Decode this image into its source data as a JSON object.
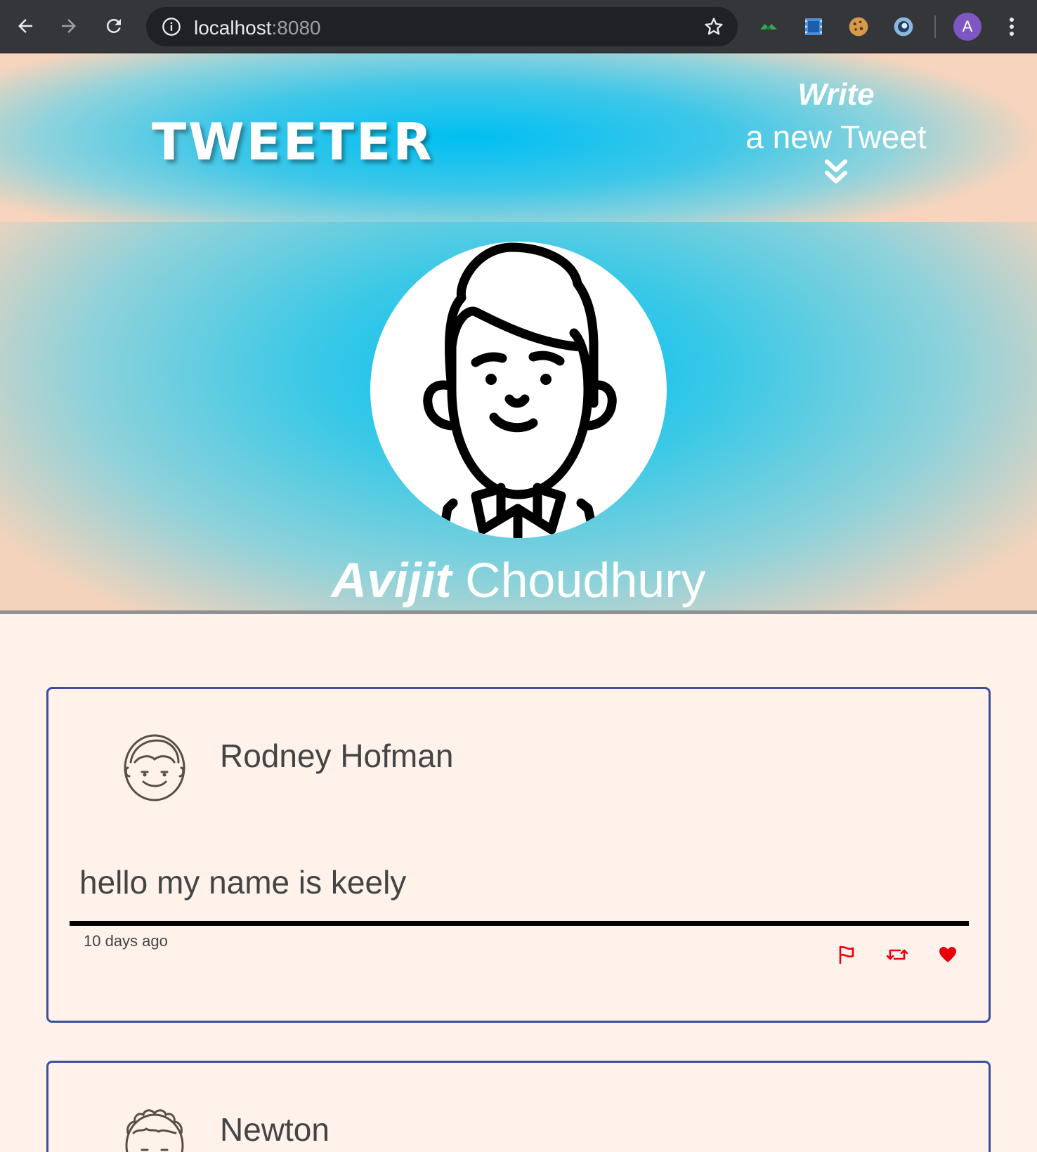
{
  "browser": {
    "url_host": "localhost",
    "url_port": ":8080",
    "profile_initial": "A"
  },
  "nav": {
    "logo": "TWEETER",
    "compose_write": "Write",
    "compose_new": "a new Tweet"
  },
  "profile": {
    "first_name": "Avijit",
    "last_name": "Choudhury"
  },
  "tweets": [
    {
      "user": "Rodney Hofman",
      "content": "hello my name is keely",
      "time": "10 days ago"
    },
    {
      "user": "Newton"
    }
  ],
  "colors": {
    "accent_red": "#e8000b",
    "card_border": "#3b4f9e",
    "page_bg": "#fef2ea",
    "sky_blue": "#00bff2"
  }
}
